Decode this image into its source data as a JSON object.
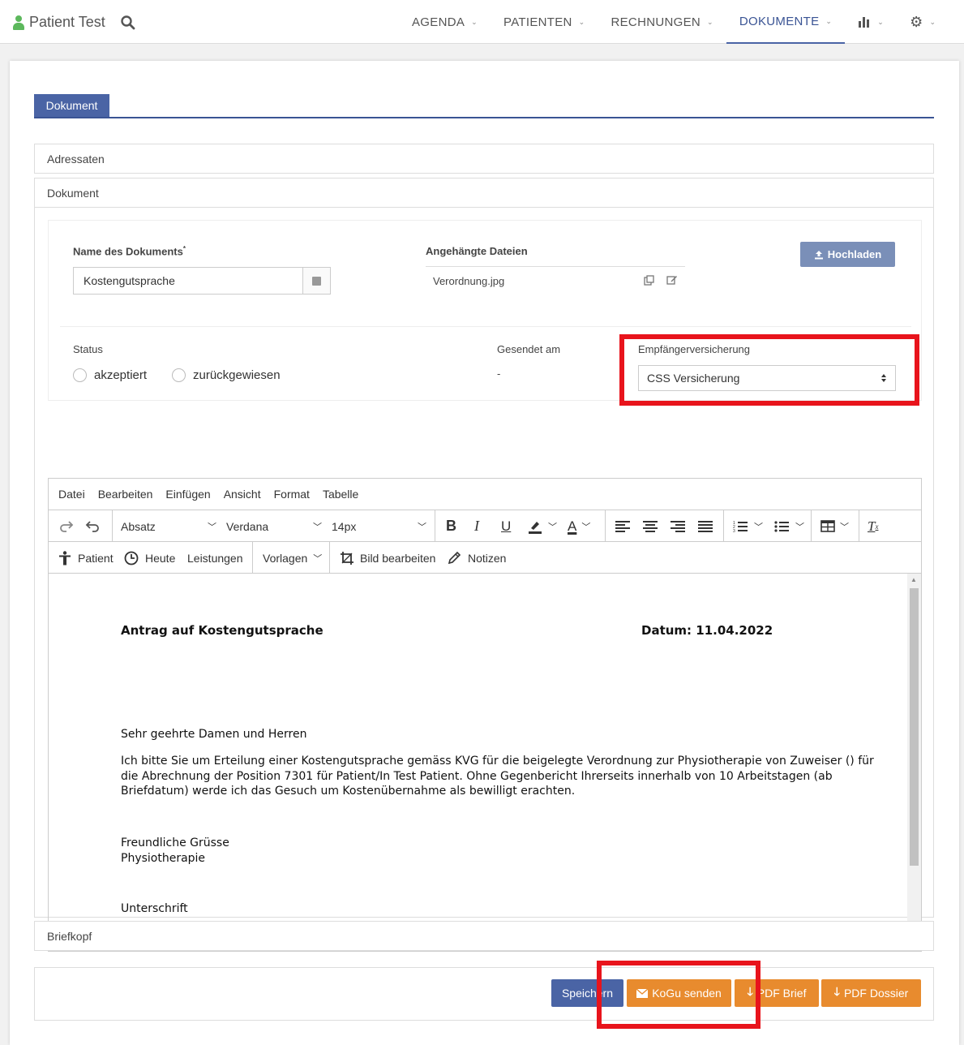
{
  "nav": {
    "brand": "Patient Test",
    "items": [
      {
        "label": "AGENDA"
      },
      {
        "label": "PATIENTEN"
      },
      {
        "label": "RECHNUNGEN"
      },
      {
        "label": "DOKUMENTE"
      }
    ],
    "active": "DOKUMENTE"
  },
  "tabs": {
    "active": "Dokument"
  },
  "sections": {
    "adressaten": "Adressaten",
    "dokument": "Dokument",
    "briefkopf": "Briefkopf"
  },
  "form": {
    "name_label": "Name des Dokuments",
    "name_required": "*",
    "name_value": "Kostengutsprache",
    "files_label": "Angehängte Dateien",
    "file_name": "Verordnung.jpg",
    "upload_label": "Hochladen",
    "status_label": "Status",
    "status_options": [
      "akzeptiert",
      "zurückgewiesen"
    ],
    "sent_label": "Gesendet am",
    "sent_value": "-",
    "insurance_label": "Empfängerversicherung",
    "insurance_value": "CSS Versicherung"
  },
  "editor": {
    "menu": [
      "Datei",
      "Bearbeiten",
      "Einfügen",
      "Ansicht",
      "Format",
      "Tabelle"
    ],
    "block_format": "Absatz",
    "font_family": "Verdana",
    "font_size": "14px",
    "custom_buttons": {
      "patient": "Patient",
      "today": "Heute",
      "services": "Leistungen",
      "templates": "Vorlagen",
      "edit_image": "Bild bearbeiten",
      "notes": "Notizen"
    },
    "doc": {
      "title": "Antrag auf Kostengutsprache",
      "date": "Datum: 11.04.2022",
      "salutation": "Sehr geehrte Damen und Herren",
      "body_line1": "Ich bitte Sie um Erteilung einer Kostengutsprache gemäss KVG für die beigelegte Verordnung zur Physiotherapie von Zuweiser () für",
      "body_line2": "die Abrechnung der Position 7301 für Patient/In Test Patient. Ohne Gegenbericht Ihrerseits innerhalb von 10 Arbeitstagen (ab",
      "body_line3": "Briefdatum) werde ich das Gesuch um Kostenübernahme als bewilligt erachten.",
      "closing1": "Freundliche Grüsse",
      "closing2": "Physiotherapie",
      "signature": "Unterschrift"
    }
  },
  "actions": {
    "save": "Speichern",
    "kogu": "KoGu senden",
    "pdf_letter": "PDF Brief",
    "pdf_dossier": "PDF Dossier"
  },
  "colors": {
    "primary": "#4a64a5",
    "orange": "#e88b2e",
    "highlight": "#e8141c",
    "brand_icon": "#5cb85c"
  }
}
